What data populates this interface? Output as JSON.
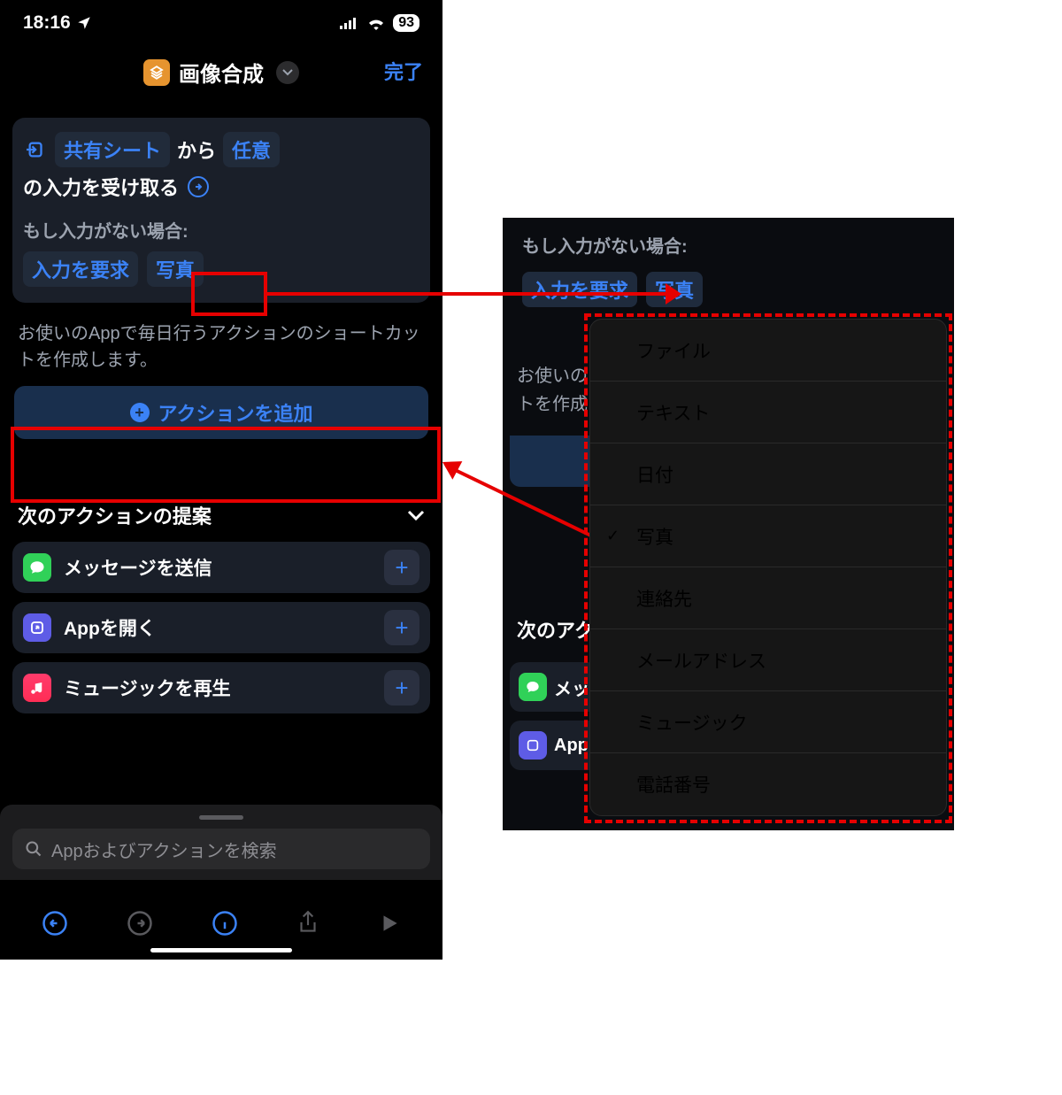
{
  "status": {
    "time": "18:16",
    "battery": "93"
  },
  "nav": {
    "title": "画像合成",
    "done": "完了"
  },
  "card": {
    "token_share": "共有シート",
    "label_from": "から",
    "token_any": "任意",
    "line2": "の入力を受け取る",
    "fallback_label": "もし入力がない場合:",
    "token_request": "入力を要求",
    "token_photo": "写真"
  },
  "hint": "お使いのAppで毎日行うアクションのショートカットを作成します。",
  "add_action": "アクションを追加",
  "suggest": {
    "header": "次のアクションの提案",
    "items": [
      {
        "label": "メッセージを送信"
      },
      {
        "label": "Appを開く"
      },
      {
        "label": "ミュージックを再生"
      }
    ]
  },
  "search_placeholder": "Appおよびアクションを検索",
  "panel2": {
    "fallback_label": "もし入力がない場合:",
    "token_request": "入力を要求",
    "token_photo": "写真",
    "bg_hint_l1": "お使いの",
    "bg_hint_l2": "トを作成",
    "bg_sugg": "次のアク",
    "bg_msg": "メッ",
    "bg_app": "App"
  },
  "menu": {
    "items": [
      "ファイル",
      "テキスト",
      "日付",
      "写真",
      "連絡先",
      "メールアドレス",
      "ミュージック",
      "電話番号"
    ],
    "selected_index": 3
  }
}
